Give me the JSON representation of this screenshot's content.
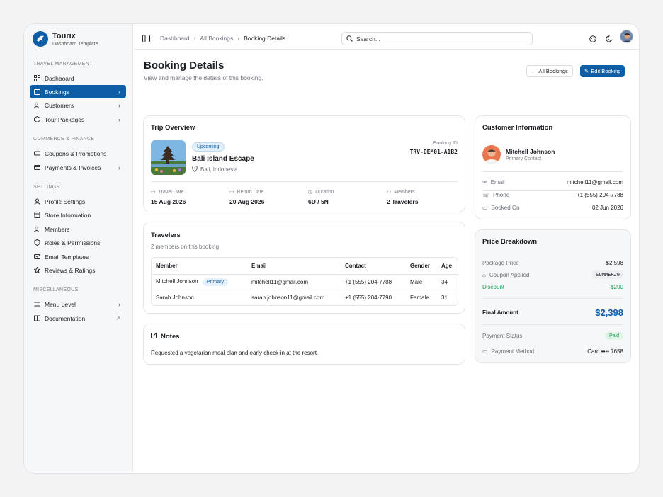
{
  "brand": {
    "name": "Tourix",
    "subtitle": "Dashboard Template"
  },
  "sidebar": {
    "sections": [
      {
        "title": "TRAVEL MANAGEMENT",
        "items": [
          {
            "label": "Dashboard",
            "icon": "grid-icon"
          },
          {
            "label": "Bookings",
            "icon": "calendar-icon",
            "active": true,
            "chevron": true
          },
          {
            "label": "Customers",
            "icon": "users-icon",
            "chevron": true
          },
          {
            "label": "Tour Packages",
            "icon": "package-icon",
            "chevron": true
          }
        ]
      },
      {
        "title": "COMMERCE & FINANCE",
        "items": [
          {
            "label": "Coupons & Promotions",
            "icon": "ticket-icon"
          },
          {
            "label": "Payments & Invoices",
            "icon": "card-icon",
            "chevron": true
          }
        ]
      },
      {
        "title": "SETTINGS",
        "items": [
          {
            "label": "Profile Settings",
            "icon": "user-icon"
          },
          {
            "label": "Store Information",
            "icon": "store-icon"
          },
          {
            "label": "Members",
            "icon": "users-icon"
          },
          {
            "label": "Roles & Permissions",
            "icon": "shield-icon"
          },
          {
            "label": "Email Templates",
            "icon": "mail-icon"
          },
          {
            "label": "Reviews & Ratings",
            "icon": "star-icon"
          }
        ]
      },
      {
        "title": "MISCELLANEOUS",
        "items": [
          {
            "label": "Menu Level",
            "icon": "menu-icon",
            "chevron": true
          },
          {
            "label": "Documentation",
            "icon": "book-icon",
            "external": true
          }
        ]
      }
    ]
  },
  "topbar": {
    "breadcrumb": [
      "Dashboard",
      "All Bookings",
      "Booking Details"
    ],
    "search_placeholder": "Search..."
  },
  "page": {
    "title": "Booking Details",
    "subtitle": "View and manage the details of this booking.",
    "back_label": "All Bookings",
    "edit_label": "Edit Booking"
  },
  "trip": {
    "card_title": "Trip Overview",
    "status": "Upcoming",
    "name": "Bali Island Escape",
    "location": "Bali, Indonesia",
    "booking_id_label": "Booking ID",
    "booking_id": "TRV-DEM01-A1B2",
    "stats": [
      {
        "label": "Travel Date",
        "value": "15 Aug 2026",
        "icon": "calendar-icon"
      },
      {
        "label": "Return Date",
        "value": "20 Aug 2026",
        "icon": "calendar-icon"
      },
      {
        "label": "Duration",
        "value": "6D / 5N",
        "icon": "clock-icon"
      },
      {
        "label": "Members",
        "value": "2 Travelers",
        "icon": "users-icon"
      }
    ]
  },
  "travelers": {
    "card_title": "Travelers",
    "subtitle": "2 members on this booking",
    "columns": [
      "Member",
      "Email",
      "Contact",
      "Gender",
      "Age"
    ],
    "rows": [
      {
        "name": "Mitchell Johnson",
        "badge": "Primary",
        "email": "mitchell11@gmail.com",
        "contact": "+1 (555) 204-7788",
        "gender": "Male",
        "age": "34"
      },
      {
        "name": "Sarah Johnson",
        "badge": "",
        "email": "sarah.johnson11@gmail.com",
        "contact": "+1 (555) 204-7790",
        "gender": "Female",
        "age": "31"
      }
    ]
  },
  "notes": {
    "card_title": "Notes",
    "text": "Requested a vegetarian meal plan and early check-in at the resort."
  },
  "customer": {
    "card_title": "Customer Information",
    "name": "Mitchell Johnson",
    "role": "Primary Contact",
    "fields": [
      {
        "label": "Email",
        "value": "mitchell11@gmail.com",
        "icon": "mail-icon"
      },
      {
        "label": "Phone",
        "value": "+1 (555) 204-7788",
        "icon": "phone-icon"
      },
      {
        "label": "Booked On",
        "value": "02 Jun 2026",
        "icon": "calendar-icon"
      }
    ]
  },
  "price": {
    "card_title": "Price Breakdown",
    "package_label": "Package Price",
    "package_value": "$2,598",
    "coupon_label": "Coupon Applied",
    "coupon_code": "SUMMER20",
    "discount_label": "Discount",
    "discount_value": "-$200",
    "final_label": "Final Amount",
    "final_value": "$2,398",
    "status_label": "Payment Status",
    "status_value": "Paid",
    "method_label": "Payment Method",
    "method_value": "Card •••• 7658"
  },
  "colors": {
    "primary": "#0d5ea6",
    "success": "#1f9d55",
    "border": "#e4e6ea"
  }
}
